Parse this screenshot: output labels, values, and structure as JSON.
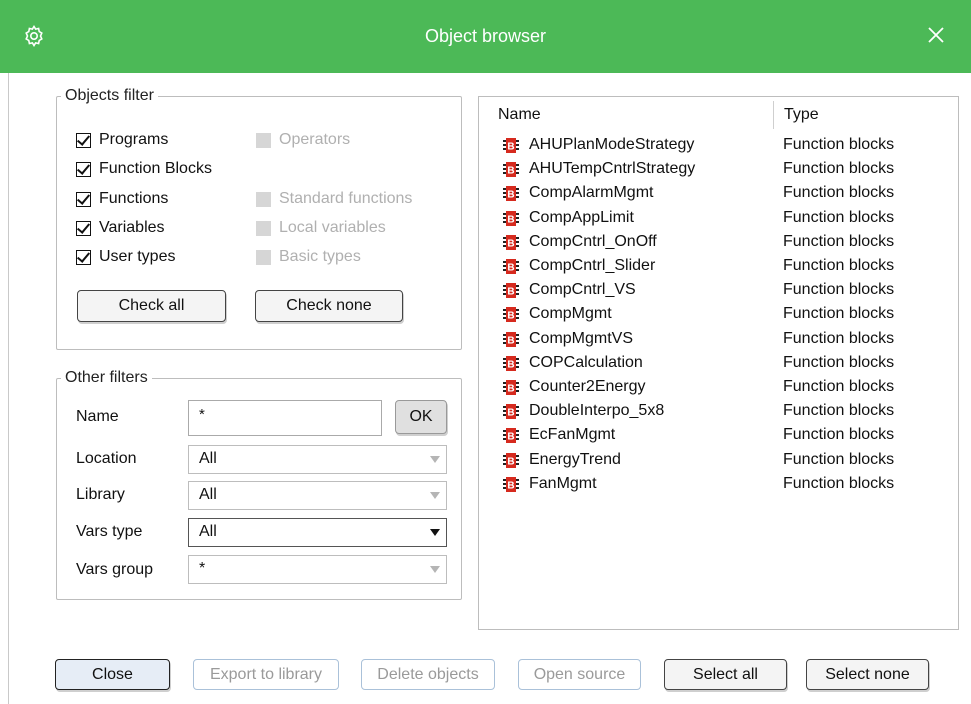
{
  "window": {
    "title": "Object browser",
    "app_icon": "gear-icon",
    "close_icon": "close-icon"
  },
  "objects_filter": {
    "legend": "Objects filter",
    "checkboxes": [
      {
        "label": "Programs",
        "checked": true,
        "enabled": true
      },
      {
        "label": "Function Blocks",
        "checked": true,
        "enabled": true
      },
      {
        "label": "Functions",
        "checked": true,
        "enabled": true
      },
      {
        "label": "Variables",
        "checked": true,
        "enabled": true
      },
      {
        "label": "User types",
        "checked": true,
        "enabled": true
      },
      {
        "label": "Operators",
        "checked": false,
        "enabled": false
      },
      {
        "label": "Standard functions",
        "checked": false,
        "enabled": false
      },
      {
        "label": "Local variables",
        "checked": false,
        "enabled": false
      },
      {
        "label": "Basic types",
        "checked": false,
        "enabled": false
      }
    ],
    "check_all": "Check all",
    "check_none": "Check none"
  },
  "other_filters": {
    "legend": "Other filters",
    "name_label": "Name",
    "name_value": "*",
    "ok_label": "OK",
    "location_label": "Location",
    "location_value": "All",
    "library_label": "Library",
    "library_value": "All",
    "vars_type_label": "Vars type",
    "vars_type_value": "All",
    "vars_group_label": "Vars group",
    "vars_group_value": "*"
  },
  "object_list": {
    "columns": [
      "Name",
      "Type"
    ],
    "rows": [
      {
        "name": "AHUPlanModeStrategy",
        "type": "Function blocks"
      },
      {
        "name": "AHUTempCntrlStrategy",
        "type": "Function blocks"
      },
      {
        "name": "CompAlarmMgmt",
        "type": "Function blocks"
      },
      {
        "name": "CompAppLimit",
        "type": "Function blocks"
      },
      {
        "name": "CompCntrl_OnOff",
        "type": "Function blocks"
      },
      {
        "name": "CompCntrl_Slider",
        "type": "Function blocks"
      },
      {
        "name": "CompCntrl_VS",
        "type": "Function blocks"
      },
      {
        "name": "CompMgmt",
        "type": "Function blocks"
      },
      {
        "name": "CompMgmtVS",
        "type": "Function blocks"
      },
      {
        "name": "COPCalculation",
        "type": "Function blocks"
      },
      {
        "name": "Counter2Energy",
        "type": "Function blocks"
      },
      {
        "name": "DoubleInterpo_5x8",
        "type": "Function blocks"
      },
      {
        "name": "EcFanMgmt",
        "type": "Function blocks"
      },
      {
        "name": "EnergyTrend",
        "type": "Function blocks"
      },
      {
        "name": "FanMgmt",
        "type": "Function blocks"
      }
    ],
    "row_icon": "function-block-icon",
    "row_icon_letter": "B",
    "row_icon_color": "#d62a1e"
  },
  "footer": {
    "close": "Close",
    "export_to_library": "Export to library",
    "delete_objects": "Delete objects",
    "open_source": "Open source",
    "select_all": "Select all",
    "select_none": "Select none"
  },
  "colors": {
    "titlebar": "#4cb957",
    "accent_button": "#e6edf6"
  }
}
